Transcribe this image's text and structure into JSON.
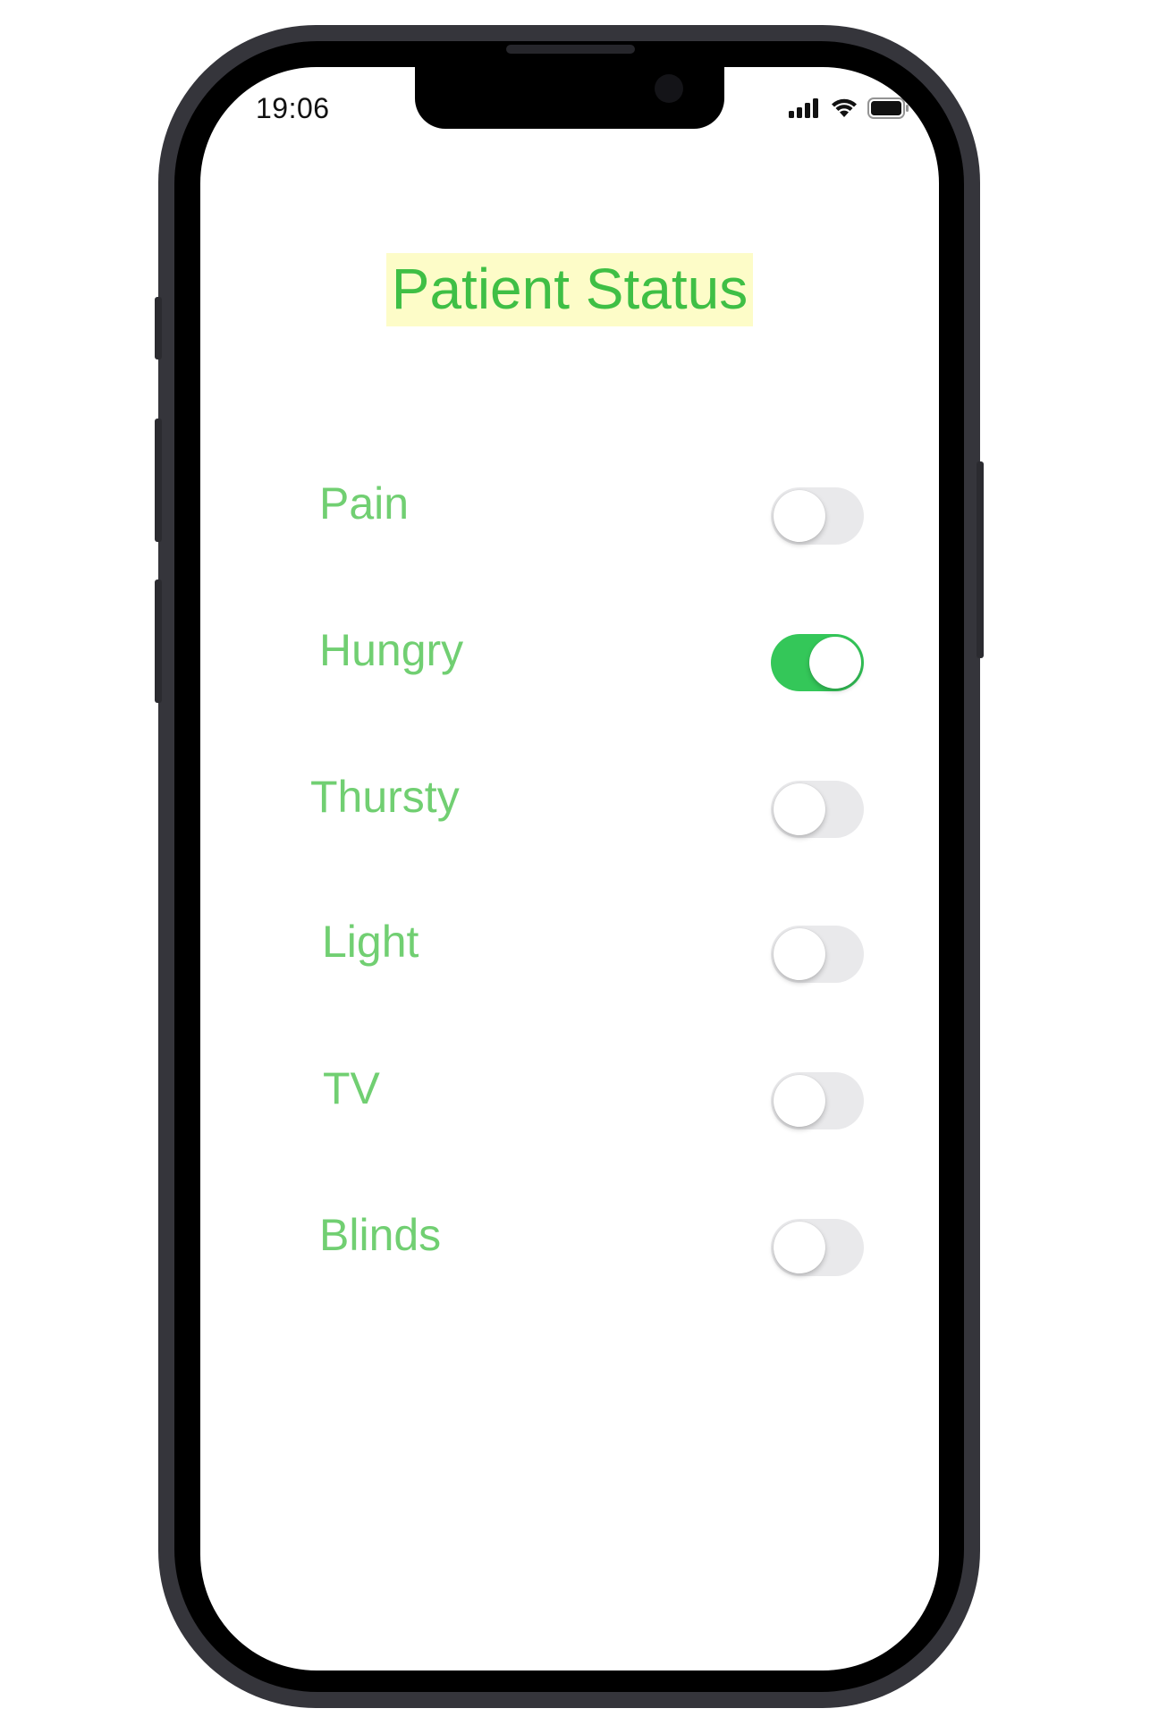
{
  "status_bar": {
    "time": "19:06",
    "signal_icon": "cellular-signal-icon",
    "wifi_icon": "wifi-icon",
    "battery_icon": "battery-icon"
  },
  "title": "Patient Status",
  "colors": {
    "title_text": "#3fbf45",
    "title_highlight": "#fdfcc8",
    "label_text": "#71cf72",
    "toggle_on": "#34c759",
    "toggle_off": "#e9e9eb"
  },
  "rows": [
    {
      "label": "Pain",
      "on": false
    },
    {
      "label": "Hungry",
      "on": true
    },
    {
      "label": "Thursty",
      "on": false
    },
    {
      "label": "Light",
      "on": false
    },
    {
      "label": "TV",
      "on": false
    },
    {
      "label": "Blinds",
      "on": false
    }
  ]
}
